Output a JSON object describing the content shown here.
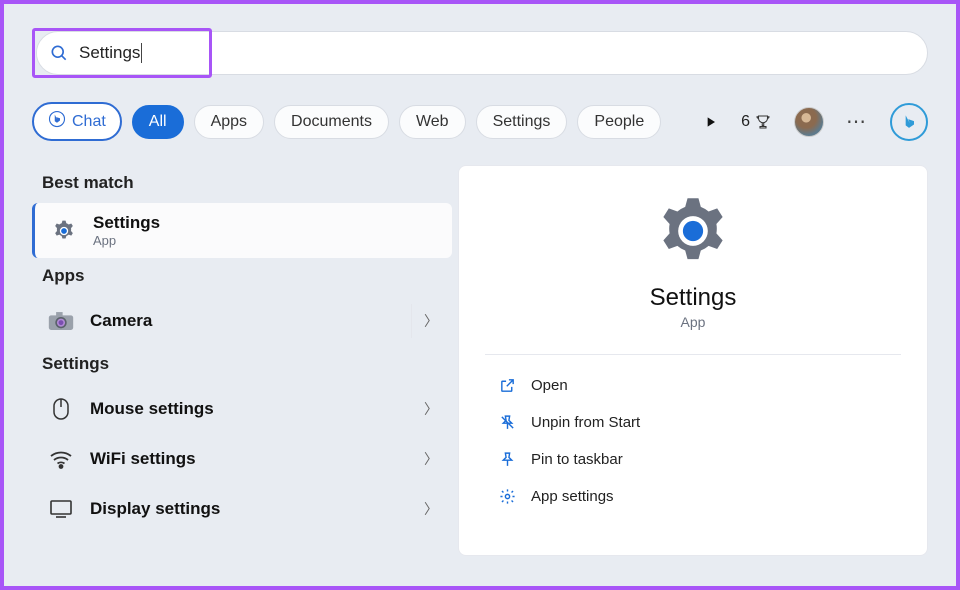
{
  "search": {
    "value": "Settings"
  },
  "chat_label": "Chat",
  "filters": [
    {
      "label": "All",
      "active": true
    },
    {
      "label": "Apps",
      "active": false
    },
    {
      "label": "Documents",
      "active": false
    },
    {
      "label": "Web",
      "active": false
    },
    {
      "label": "Settings",
      "active": false
    },
    {
      "label": "People",
      "active": false
    }
  ],
  "points": "6",
  "sections": {
    "best_match": "Best match",
    "apps": "Apps",
    "settings": "Settings"
  },
  "results": {
    "best": {
      "title": "Settings",
      "subtitle": "App"
    },
    "camera": "Camera",
    "mouse": {
      "pre": "Mouse ",
      "bold": "settings"
    },
    "wifi": {
      "pre": "WiFi ",
      "bold": "settings"
    },
    "display": {
      "pre": "Display ",
      "bold": "settings"
    }
  },
  "detail": {
    "title": "Settings",
    "subtitle": "App",
    "actions": {
      "open": "Open",
      "unpin": "Unpin from Start",
      "pin": "Pin to taskbar",
      "appsettings": "App settings"
    }
  }
}
